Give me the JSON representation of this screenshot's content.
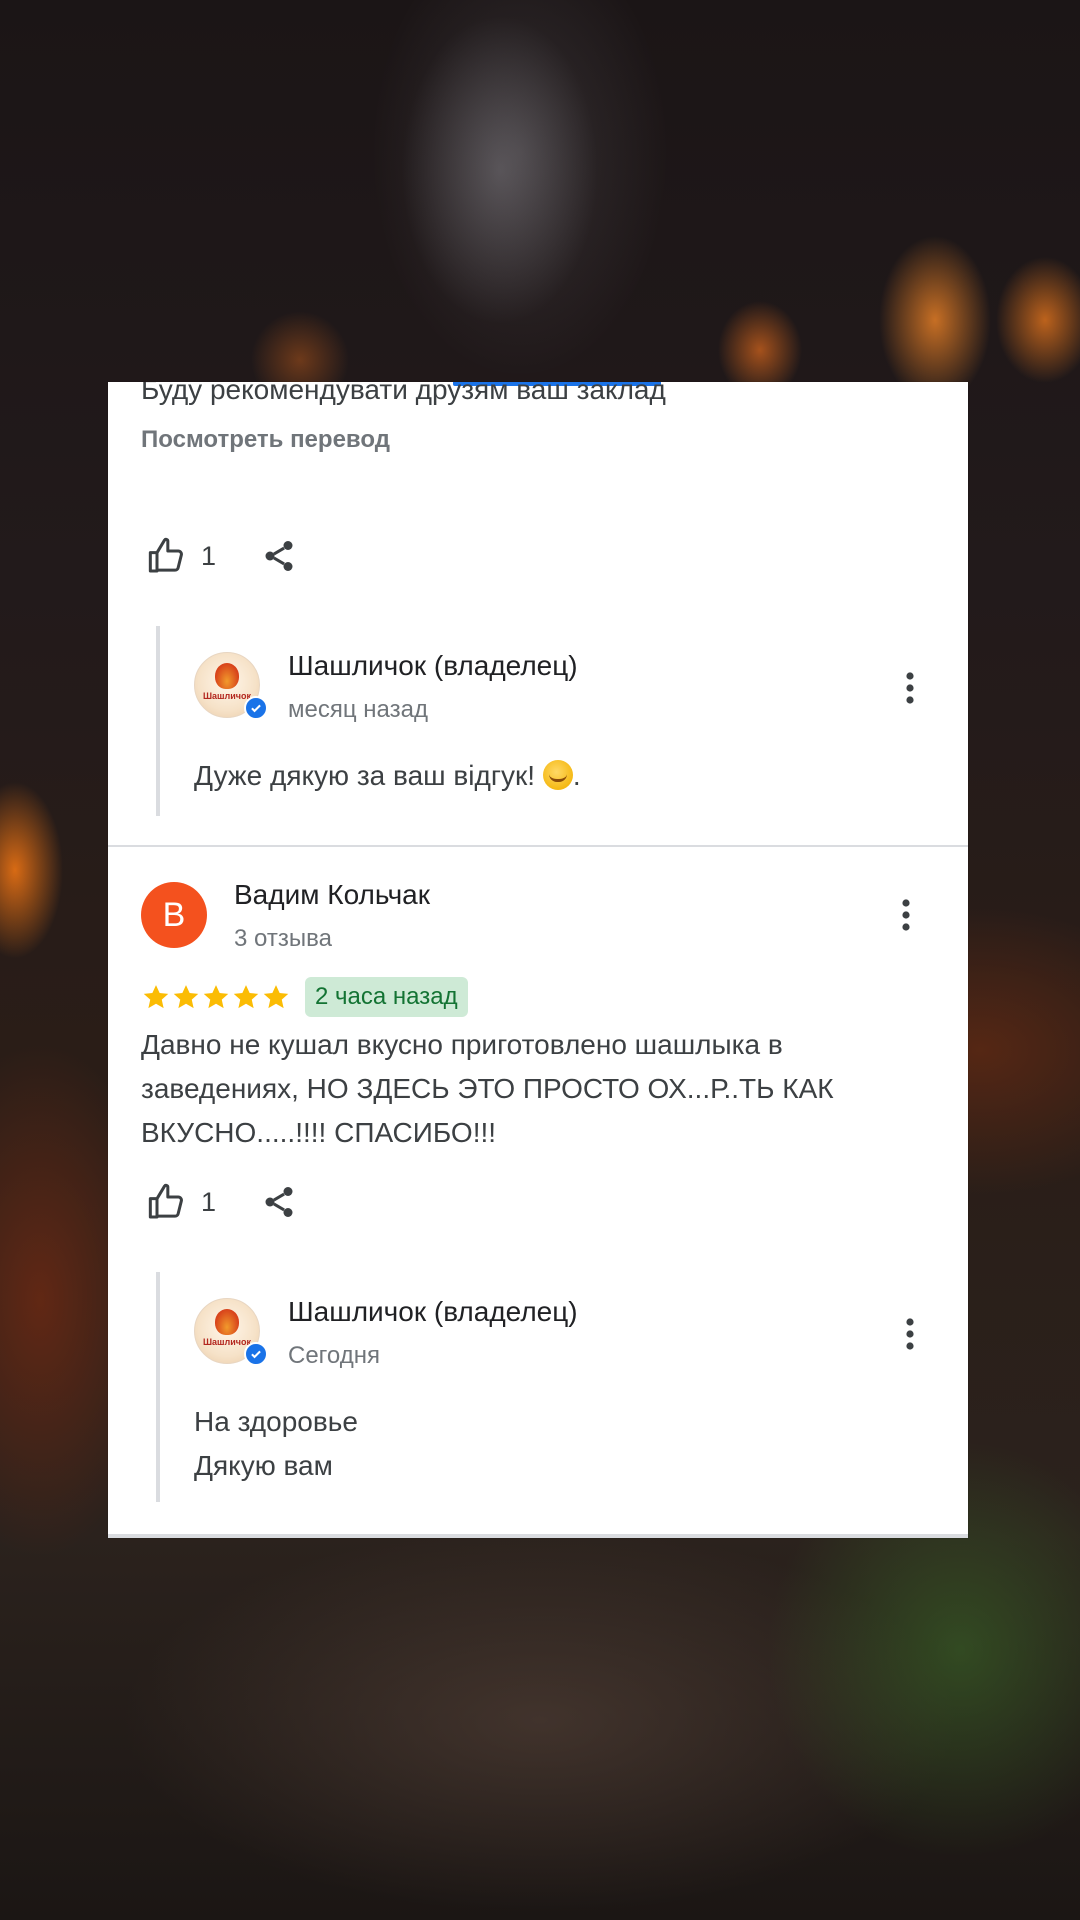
{
  "review_top": {
    "cut_text": "Буду рекомендувати друзям ваш заклад",
    "translate_link": "Посмотреть перевод",
    "likes": "1",
    "owner_reply": {
      "avatar_logo_text": "Шашличок",
      "name": "Шашличок (владелец)",
      "time": "месяц назад",
      "text": "Дуже дякую за ваш відгук! ",
      "text_suffix": ".",
      "emoji": "smiling-face"
    }
  },
  "review_second": {
    "avatar_letter": "В",
    "avatar_color": "#f4511e",
    "name": "Вадим Кольчак",
    "reviews_count": "3 отзыва",
    "rating": 5,
    "rating_max": 5,
    "time_chip": "2 часа назад",
    "text": "Давно не кушал вкусно приготовлено шашлыка в заведениях, НО ЗДЕСЬ ЭТО ПРОСТО ОХ...Р..ТЬ КАК ВКУСНО.....!!!! СПАСИБО!!!",
    "likes": "1",
    "owner_reply": {
      "avatar_logo_text": "Шашличок",
      "name": "Шашличок (владелец)",
      "time": "Сегодня",
      "text_line1": "На здоровье",
      "text_line2": "Дякую вам"
    }
  },
  "colors": {
    "accent": "#1a73e8",
    "star": "#fbbc04",
    "chip_bg": "#ceead6",
    "chip_text": "#137333"
  },
  "icons": [
    "thumb-up-icon",
    "share-icon",
    "more-vert-icon",
    "verified-icon",
    "star-icon"
  ]
}
